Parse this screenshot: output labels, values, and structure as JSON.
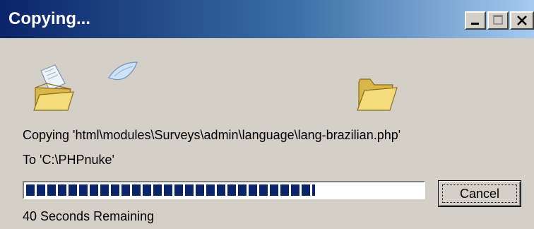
{
  "window": {
    "title": "Copying...",
    "controls": {
      "minimize": "minimize",
      "maximize": "maximize",
      "close": "close"
    }
  },
  "icons": {
    "source_folder": "open-folder-icon",
    "flying_document": "flying-document-icon",
    "destination_folder": "open-folder-icon"
  },
  "copy": {
    "from_text": "Copying 'html\\modules\\Surveys\\admin\\language\\lang-brazilian.php'",
    "to_text": "To 'C:\\PHPnuke'",
    "progress_fraction": 0.73,
    "remaining_text": "40 Seconds Remaining"
  },
  "buttons": {
    "cancel_label": "Cancel"
  },
  "colors": {
    "title_gradient_start": "#0a246a",
    "title_gradient_end": "#a6caf0",
    "progress_block": "#0a246a",
    "face": "#d4d0c8"
  }
}
